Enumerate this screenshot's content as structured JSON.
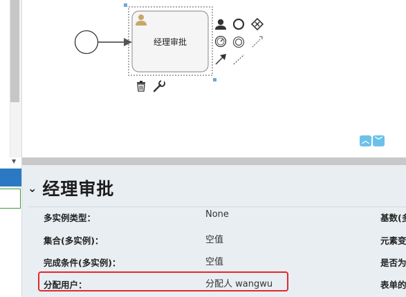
{
  "diagram": {
    "task_label": "经理审批"
  },
  "properties": {
    "title": "经理审批",
    "rows": [
      {
        "label": "多实例类型：",
        "value": "None",
        "right": "基数(多"
      },
      {
        "label": "集合(多实例)：",
        "value": "空值",
        "right": "元素变"
      },
      {
        "label": "完成条件(多实例)：",
        "value": "空值",
        "right": "是否为"
      },
      {
        "label": "分配用户：",
        "value": "分配人 wangwu",
        "right": "表单的"
      }
    ]
  },
  "icons": {
    "collapse": "chevron-down-icon",
    "zoom_in": "chevron-up-icon",
    "zoom_out": "chevron-down-icon",
    "user_task": "user-icon",
    "delete": "trash-icon",
    "edit": "wrench-icon"
  },
  "colors": {
    "accent_blue": "#2b79c2",
    "highlight_red": "#e5262a",
    "zoom_btn": "#6cc1ea"
  }
}
